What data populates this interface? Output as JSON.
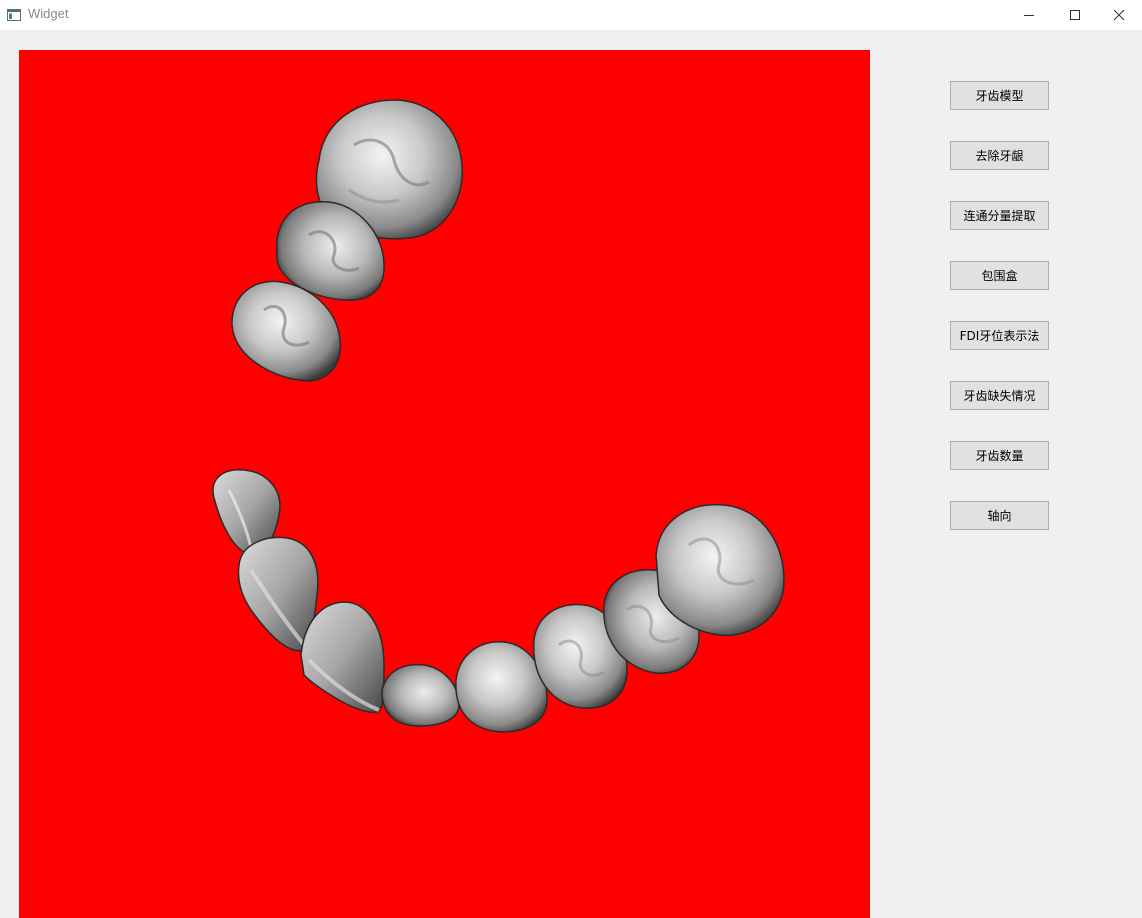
{
  "window": {
    "title": "Widget",
    "icons": {
      "app": "app-window-icon",
      "minimize": "minimize-icon",
      "maximize": "maximize-icon",
      "close": "close-icon"
    }
  },
  "viewport": {
    "background_color": "#ff0000",
    "content": "3D tooth segmentation model render"
  },
  "buttons": [
    {
      "label": "牙齿模型"
    },
    {
      "label": "去除牙龈"
    },
    {
      "label": "连通分量提取"
    },
    {
      "label": "包围盒"
    },
    {
      "label": "FDI牙位表示法"
    },
    {
      "label": "牙齿缺失情况"
    },
    {
      "label": "牙齿数量"
    },
    {
      "label": "轴向"
    }
  ]
}
